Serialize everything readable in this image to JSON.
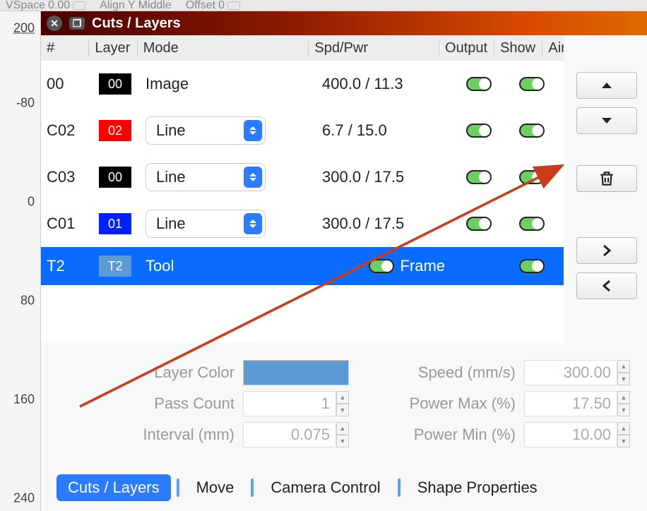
{
  "toolbar_fragments": {
    "vspace_label": "VSpace",
    "vspace_val": "0.00",
    "align_label": "Align Y",
    "align_val": "Middle",
    "offset_label": "Offset",
    "offset_val": "0"
  },
  "ruler": [
    "200",
    "-80",
    "0",
    "80",
    "160",
    "240"
  ],
  "panel": {
    "title": "Cuts / Layers",
    "headers": {
      "num": "#",
      "layer": "Layer",
      "mode": "Mode",
      "spd": "Spd/Pwr",
      "output": "Output",
      "show": "Show",
      "air": "Air"
    },
    "rows": [
      {
        "id": "00",
        "badge": "00",
        "badge_bg": "#000000",
        "mode_type": "text",
        "mode": "Image",
        "spd": "400.0 / 11.3",
        "out": true,
        "show": true,
        "selected": false
      },
      {
        "id": "C02",
        "badge": "02",
        "badge_bg": "#ff0000",
        "mode_type": "select",
        "mode": "Line",
        "spd": "6.7 / 15.0",
        "out": true,
        "show": true,
        "selected": false
      },
      {
        "id": "C03",
        "badge": "00",
        "badge_bg": "#000000",
        "mode_type": "select",
        "mode": "Line",
        "spd": "300.0 / 17.5",
        "out": true,
        "show": true,
        "selected": false
      },
      {
        "id": "C01",
        "badge": "01",
        "badge_bg": "#0020ff",
        "mode_type": "select",
        "mode": "Line",
        "spd": "300.0 / 17.5",
        "out": true,
        "show": true,
        "selected": false
      },
      {
        "id": "T2",
        "badge": "T2",
        "badge_bg": "#5b9bd5",
        "mode_type": "text",
        "mode": "Tool",
        "spd": "Frame",
        "out": true,
        "show": true,
        "selected": true,
        "out_in_spd": true
      }
    ]
  },
  "props": {
    "layer_color_label": "Layer Color",
    "layer_color": "#5b9bd5",
    "pass_count_label": "Pass Count",
    "pass_count": "1",
    "interval_label": "Interval (mm)",
    "interval": "0.075",
    "speed_label": "Speed (mm/s)",
    "speed": "300.00",
    "pmax_label": "Power Max (%)",
    "pmax": "17.50",
    "pmin_label": "Power Min (%)",
    "pmin": "10.00"
  },
  "tabs": [
    "Cuts / Layers",
    "Move",
    "Camera Control",
    "Shape Properties"
  ],
  "active_tab": 0
}
